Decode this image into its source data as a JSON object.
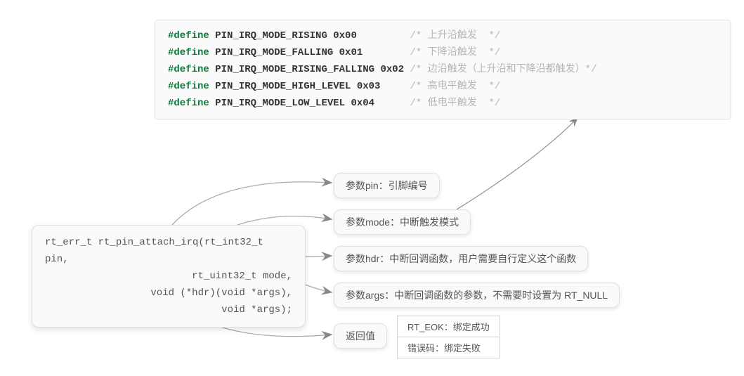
{
  "code": {
    "lines": [
      {
        "kw": "#define",
        "macro": "PIN_IRQ_MODE_RISING 0x00",
        "pad": "         ",
        "comment": "/* 上升沿触发  */"
      },
      {
        "kw": "#define",
        "macro": "PIN_IRQ_MODE_FALLING 0x01",
        "pad": "        ",
        "comment": "/* 下降沿触发  */"
      },
      {
        "kw": "#define",
        "macro": "PIN_IRQ_MODE_RISING_FALLING 0x02",
        "pad": " ",
        "comment": "/* 边沿触发（上升沿和下降沿都触发）*/"
      },
      {
        "kw": "#define",
        "macro": "PIN_IRQ_MODE_HIGH_LEVEL 0x03",
        "pad": "     ",
        "comment": "/* 高电平触发  */"
      },
      {
        "kw": "#define",
        "macro": "PIN_IRQ_MODE_LOW_LEVEL 0x04",
        "pad": "      ",
        "comment": "/* 低电平触发  */"
      }
    ]
  },
  "fn": {
    "l1": "rt_err_t rt_pin_attach_irq(rt_int32_t pin,",
    "l2": "rt_uint32_t mode,",
    "l3": "void (*hdr)(void *args),",
    "l4": "void *args);"
  },
  "boxes": {
    "b1": "参数pin：引脚编号",
    "b2": "参数mode：中断触发模式",
    "b3": "参数hdr：中断回调函数，用户需要自行定义这个函数",
    "b4": "参数args：中断回调函数的参数，不需要时设置为 RT_NULL",
    "b5": "返回值"
  },
  "ret": {
    "r1": "RT_EOK：绑定成功",
    "r2": "错误码：绑定失败"
  }
}
